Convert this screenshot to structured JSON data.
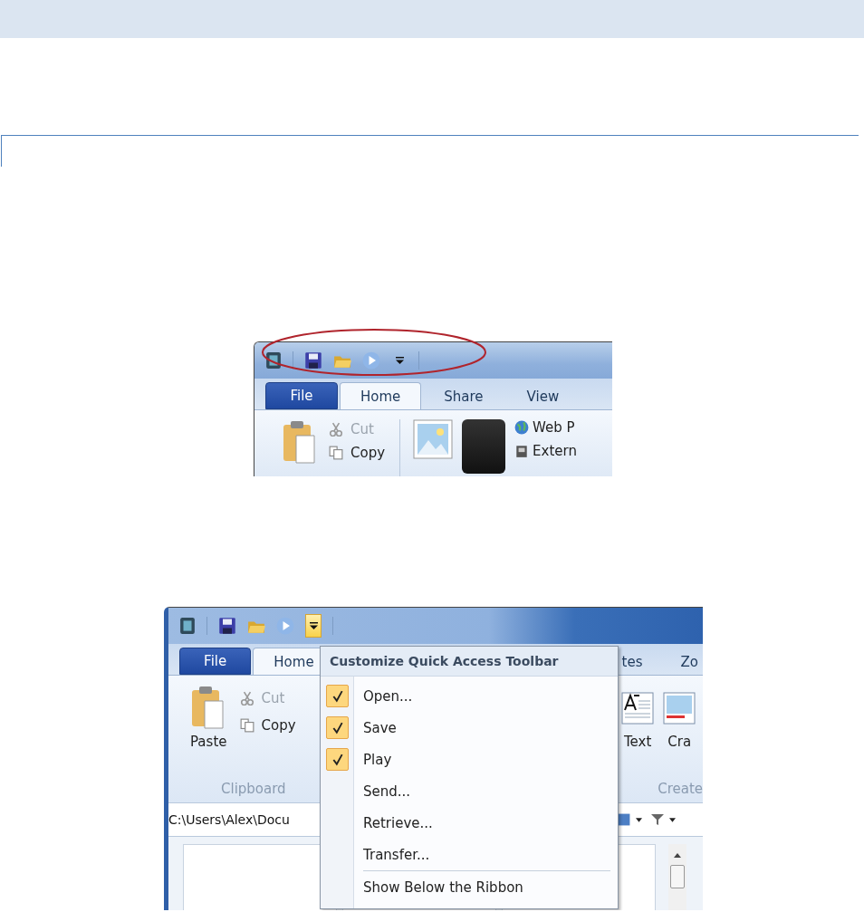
{
  "figure_1": {
    "qat_menu_open": false,
    "file_tab": "File",
    "tabs": [
      {
        "label": "Home",
        "selected": true
      },
      {
        "label": "Share",
        "selected": false
      },
      {
        "label": "View",
        "selected": false
      }
    ],
    "commands": [
      {
        "label": "Cut",
        "disabled": true
      },
      {
        "label": "Copy",
        "disabled": false
      }
    ],
    "links": [
      "Web P",
      "Extern"
    ]
  },
  "figure_2": {
    "qat_menu_open": true,
    "file_tab": "File",
    "tabs": [
      {
        "label": "Home",
        "selected": true
      },
      {
        "label": "tes",
        "selected": false
      },
      {
        "label": "Zo",
        "selected": false
      }
    ],
    "paste": "Paste",
    "commands": [
      {
        "label": "Cut",
        "disabled": true
      },
      {
        "label": "Copy",
        "disabled": false
      }
    ],
    "groups": [
      "Clipboard",
      "Create"
    ],
    "gallery": [
      "Text",
      "Cra"
    ],
    "path": "C:\\Users\\Alex\\Docu",
    "menu": {
      "title": "Customize Quick Access Toolbar",
      "items": [
        {
          "label": "Open...",
          "checked": true
        },
        {
          "label": "Save",
          "checked": true
        },
        {
          "label": "Play",
          "checked": true
        },
        {
          "label": "Send...",
          "checked": false
        },
        {
          "label": "Retrieve...",
          "checked": false
        },
        {
          "label": "Transfer...",
          "checked": false
        }
      ],
      "footer": "Show Below the Ribbon"
    }
  }
}
